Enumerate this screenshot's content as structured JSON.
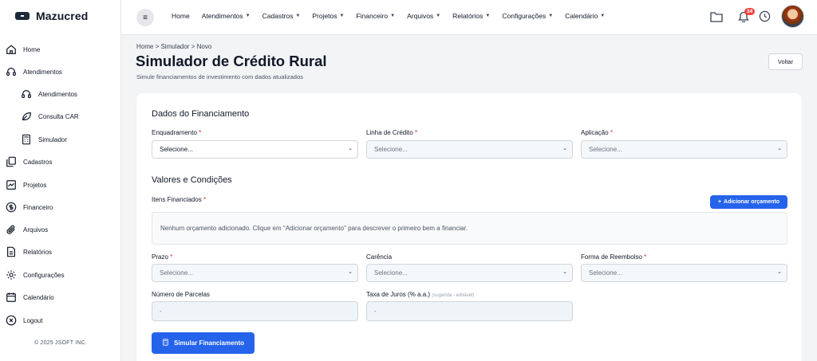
{
  "brand": {
    "name": "Mazucred"
  },
  "sidebar": {
    "items": [
      {
        "label": "Home",
        "icon": "home-icon"
      },
      {
        "label": "Atendimentos",
        "icon": "headset-icon"
      },
      {
        "label": "Atendimentos",
        "icon": "headset-icon"
      },
      {
        "label": "Consulta CAR",
        "icon": "leaf-icon"
      },
      {
        "label": "Simulador",
        "icon": "calculator-icon"
      },
      {
        "label": "Cadastros",
        "icon": "copy-icon"
      },
      {
        "label": "Projetos",
        "icon": "chart-icon"
      },
      {
        "label": "Financeiro",
        "icon": "dollar-icon"
      },
      {
        "label": "Arquivos",
        "icon": "paperclip-icon"
      },
      {
        "label": "Relatórios",
        "icon": "file-icon"
      },
      {
        "label": "Configurações",
        "icon": "gear-icon"
      },
      {
        "label": "Calendário",
        "icon": "calendar-icon"
      },
      {
        "label": "Logout",
        "icon": "logout-icon"
      }
    ],
    "copyright": "© 2025 JSOFT INC."
  },
  "topbar": {
    "menu_icon": "≡",
    "nav": [
      "Home",
      "Atendimentos",
      "Cadastros",
      "Projetos",
      "Financeiro",
      "Arquivos",
      "Relatórios",
      "Configurações",
      "Calendário"
    ],
    "notifications_count": "34"
  },
  "page": {
    "breadcrumb": "Home > Simulador > Novo",
    "title": "Simulador de Crédito Rural",
    "subtitle": "Simule financiamentos de investimento com dados atualizados",
    "back_label": "Voltar"
  },
  "form": {
    "section1_title": "Dados do Financiamento",
    "enquadramento_label": "Enquadramento",
    "enquadramento_value": "Selecione...",
    "linha_label": "Linha de Crédito",
    "linha_value": "Selecione...",
    "aplicacao_label": "Aplicação",
    "aplicacao_value": "Selecione...",
    "section2_title": "Valores e Condições",
    "itens_label": "Itens Financiados",
    "add_label": "Adicionar orçamento",
    "empty_text": "Nenhum orçamento adicionado. Clique em \"Adicionar orçamento\" para descrever o primeiro bem a financiar.",
    "prazo_label": "Prazo",
    "prazo_value": "Selecione...",
    "carencia_label": "Carência",
    "carencia_value": "Selecione...",
    "forma_label": "Forma de Reembolso",
    "forma_value": "Selecione...",
    "parcelas_label": "Número de Parcelas",
    "parcelas_value": "-",
    "taxa_label": "Taxa de Juros (% a.a.)",
    "taxa_hint": "(sugerida - editável)",
    "taxa_value": "-",
    "simular_label": "Simular Financiamento",
    "required_mark": "*"
  },
  "colors": {
    "primary": "#2563eb",
    "badge": "#ef4444",
    "required": "#dc2626"
  }
}
